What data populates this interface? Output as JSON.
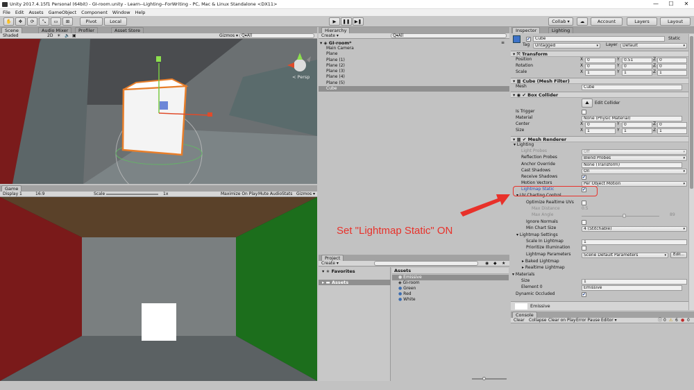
{
  "window": {
    "title": "Unity 2017.4.15f1 Personal (64bit) - GI-room.unity - Learn--Lighting--ForWriting - PC, Mac & Linux Standalone <DX11>",
    "minimize": "—",
    "maximize": "☐",
    "close": "✕"
  },
  "menu": [
    "File",
    "Edit",
    "Assets",
    "GameObject",
    "Component",
    "Window",
    "Help"
  ],
  "toolbar": {
    "pivot": "Pivot",
    "local": "Local",
    "play": "▶",
    "pause": "❚❚",
    "step": "▶❚",
    "collab": "Collab ▾",
    "account": "Account",
    "layers": "Layers",
    "layout": "Layout"
  },
  "scene": {
    "tabs": [
      "Scene",
      "Audio Mixer",
      "Profiler",
      "Asset Store"
    ],
    "shading": "Shaded",
    "mode2d": "2D",
    "gizmos": "Gizmos ▾",
    "search": "Q▾All",
    "persp": "< Persp"
  },
  "game": {
    "tab": "Game",
    "display": "Display 1",
    "aspect": "16:9",
    "scale_label": "Scale",
    "scale_value": "1x",
    "buttons": [
      "Maximize On Play",
      "Mute Audio",
      "Stats",
      "Gizmos ▾"
    ]
  },
  "hierarchy": {
    "tab": "Hierarchy",
    "create": "Create ▾",
    "search": "Q▾All",
    "scene": "GI-room*",
    "items": [
      "Main Camera",
      "Plane",
      "Plane (1)",
      "Plane (2)",
      "Plane (3)",
      "Plane (4)",
      "Plane (5)",
      "Cube"
    ],
    "selected": "Cube"
  },
  "project": {
    "tab": "Project",
    "create": "Create ▾",
    "favorites": "Favorites",
    "assets_folder": "Assets",
    "assets_header": "Assets",
    "items": [
      "Emissive",
      "GI-room",
      "Green",
      "Red",
      "White"
    ]
  },
  "inspector": {
    "tabs": [
      "Inspector",
      "Lighting"
    ],
    "object_name": "Cube",
    "static_label": "Static",
    "tag_label": "Tag",
    "tag_value": "Untagged",
    "layer_label": "Layer",
    "layer_value": "Default",
    "transform": {
      "header": "Transform",
      "rows": [
        {
          "label": "Position",
          "x": "0",
          "y": "0.51",
          "z": "0"
        },
        {
          "label": "Rotation",
          "x": "0",
          "y": "0",
          "z": "0"
        },
        {
          "label": "Scale",
          "x": "1",
          "y": "1",
          "z": "1"
        }
      ]
    },
    "mesh_filter": {
      "header": "Cube (Mesh Filter)",
      "label": "Mesh",
      "value": "Cube"
    },
    "box_collider": {
      "header": "Box Collider",
      "edit": "Edit Collider",
      "is_trigger": "Is Trigger",
      "material_label": "Material",
      "material_value": "None (Physic Material)",
      "center_label": "Center",
      "center": [
        "0",
        "0",
        "0"
      ],
      "size_label": "Size",
      "size": [
        "1",
        "1",
        "1"
      ]
    },
    "mesh_renderer": {
      "header": "Mesh Renderer",
      "lighting": "Lighting",
      "rows": [
        {
          "label": "Light Probes",
          "value": "Off"
        },
        {
          "label": "Reflection Probes",
          "value": "Blend Probes"
        },
        {
          "label": "Anchor Override",
          "value": "None (Transform)"
        },
        {
          "label": "Cast Shadows",
          "value": "On"
        },
        {
          "label": "Receive Shadows",
          "value": "✔"
        },
        {
          "label": "Motion Vectors",
          "value": "Per Object Motion"
        },
        {
          "label": "Lightmap Static",
          "value": "✔"
        }
      ],
      "uv_control": "UV Charting Control",
      "optimize": "Optimize Realtime UVs",
      "max_distance": "Max Distance",
      "max_distance_value": "0.5",
      "max_angle": "Max Angle",
      "max_angle_value": "89",
      "ignore_normals": "Ignore Normals",
      "min_chart": "Min Chart Size",
      "min_chart_value": "4 (Stitchable)",
      "lightmap_settings": "Lightmap Settings",
      "scale_lightmap": "Scale In Lightmap",
      "scale_lightmap_value": "1",
      "prioritize": "Prioritize Illumination",
      "params": "Lightmap Parameters",
      "params_value": "Scene Default Parameters",
      "edit": "Edit...",
      "baked": "Baked Lightmap",
      "realtime": "Realtime Lightmap",
      "materials": "Materials",
      "mat_size": "Size",
      "mat_size_value": "1",
      "element0": "Element 0",
      "element0_value": "Emissive",
      "dynamic_occluded": "Dynamic Occluded",
      "material_name": "Emissive"
    }
  },
  "console": {
    "tab": "Console",
    "buttons": [
      "Clear",
      "Collapse",
      "Clear on Play",
      "Error Pause",
      "Editor ▾"
    ],
    "counts": [
      "0",
      "6",
      "0"
    ]
  },
  "annotation": {
    "text": "Set \"Lightmap Static\" ON",
    "color": "#e8312a"
  }
}
